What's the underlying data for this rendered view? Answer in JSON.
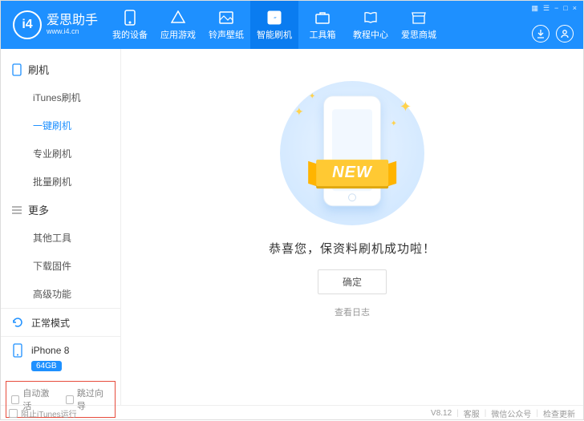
{
  "header": {
    "logo_letters": "i4",
    "title": "爱思助手",
    "subtitle": "www.i4.cn",
    "nav": [
      {
        "label": "我的设备"
      },
      {
        "label": "应用游戏"
      },
      {
        "label": "铃声壁纸"
      },
      {
        "label": "智能刷机",
        "active": true
      },
      {
        "label": "工具箱"
      },
      {
        "label": "教程中心"
      },
      {
        "label": "爱思商城"
      }
    ],
    "win_controls": [
      "▦",
      "☰",
      "−",
      "□",
      "×"
    ]
  },
  "sidebar": {
    "group1": {
      "title": "刷机",
      "items": [
        {
          "label": "iTunes刷机"
        },
        {
          "label": "一键刷机",
          "active": true
        },
        {
          "label": "专业刷机"
        },
        {
          "label": "批量刷机"
        }
      ]
    },
    "group2": {
      "title": "更多",
      "items": [
        {
          "label": "其他工具"
        },
        {
          "label": "下载固件"
        },
        {
          "label": "高级功能"
        }
      ]
    },
    "mode": "正常模式",
    "device": {
      "name": "iPhone 8",
      "storage": "64GB"
    },
    "checks": [
      {
        "label": "自动激活"
      },
      {
        "label": "跳过向导"
      }
    ]
  },
  "main": {
    "ribbon": "NEW",
    "success": "恭喜您，保资料刷机成功啦！",
    "ok": "确定",
    "view_log": "查看日志"
  },
  "footer": {
    "block_itunes": "阻止iTunes运行",
    "version": "V8.12",
    "support": "客服",
    "wechat": "微信公众号",
    "update": "检查更新"
  }
}
